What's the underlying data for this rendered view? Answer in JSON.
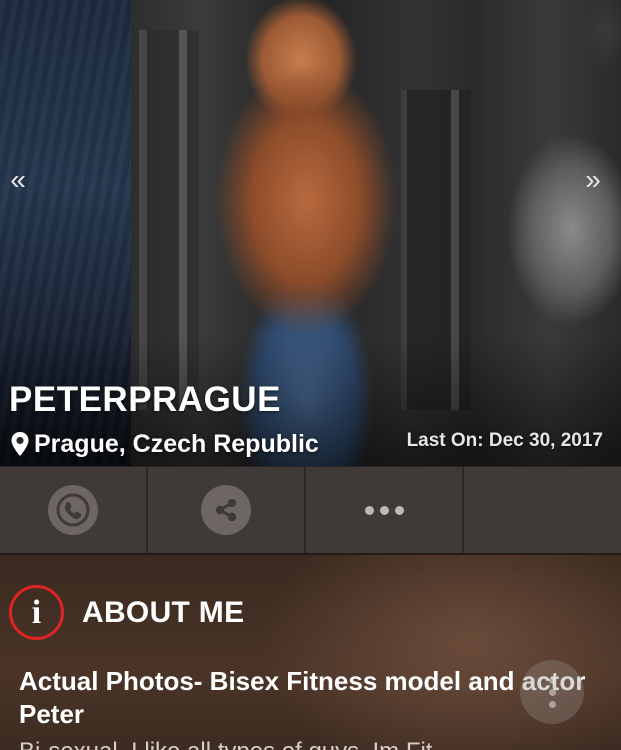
{
  "profile": {
    "username": "PETERPRAGUE",
    "location": "Prague, Czech Republic",
    "last_on": "Last On: Dec 30, 2017"
  },
  "carousel": {
    "prev_label": "«",
    "next_label": "»"
  },
  "actions": {
    "call_icon": "phone-icon",
    "share_icon": "share-icon",
    "more_icon": "more-horizontal-icon"
  },
  "about": {
    "info_glyph": "i",
    "title": "ABOUT ME",
    "headline": "Actual Photos- Bisex Fitness model and actor Peter",
    "body_preview": "Bi-sexual, I like all types of guys. Im Fit..."
  },
  "colors": {
    "accent_red": "#e02424",
    "action_bar": "#3f3937",
    "about_bg": "#4a3427"
  }
}
